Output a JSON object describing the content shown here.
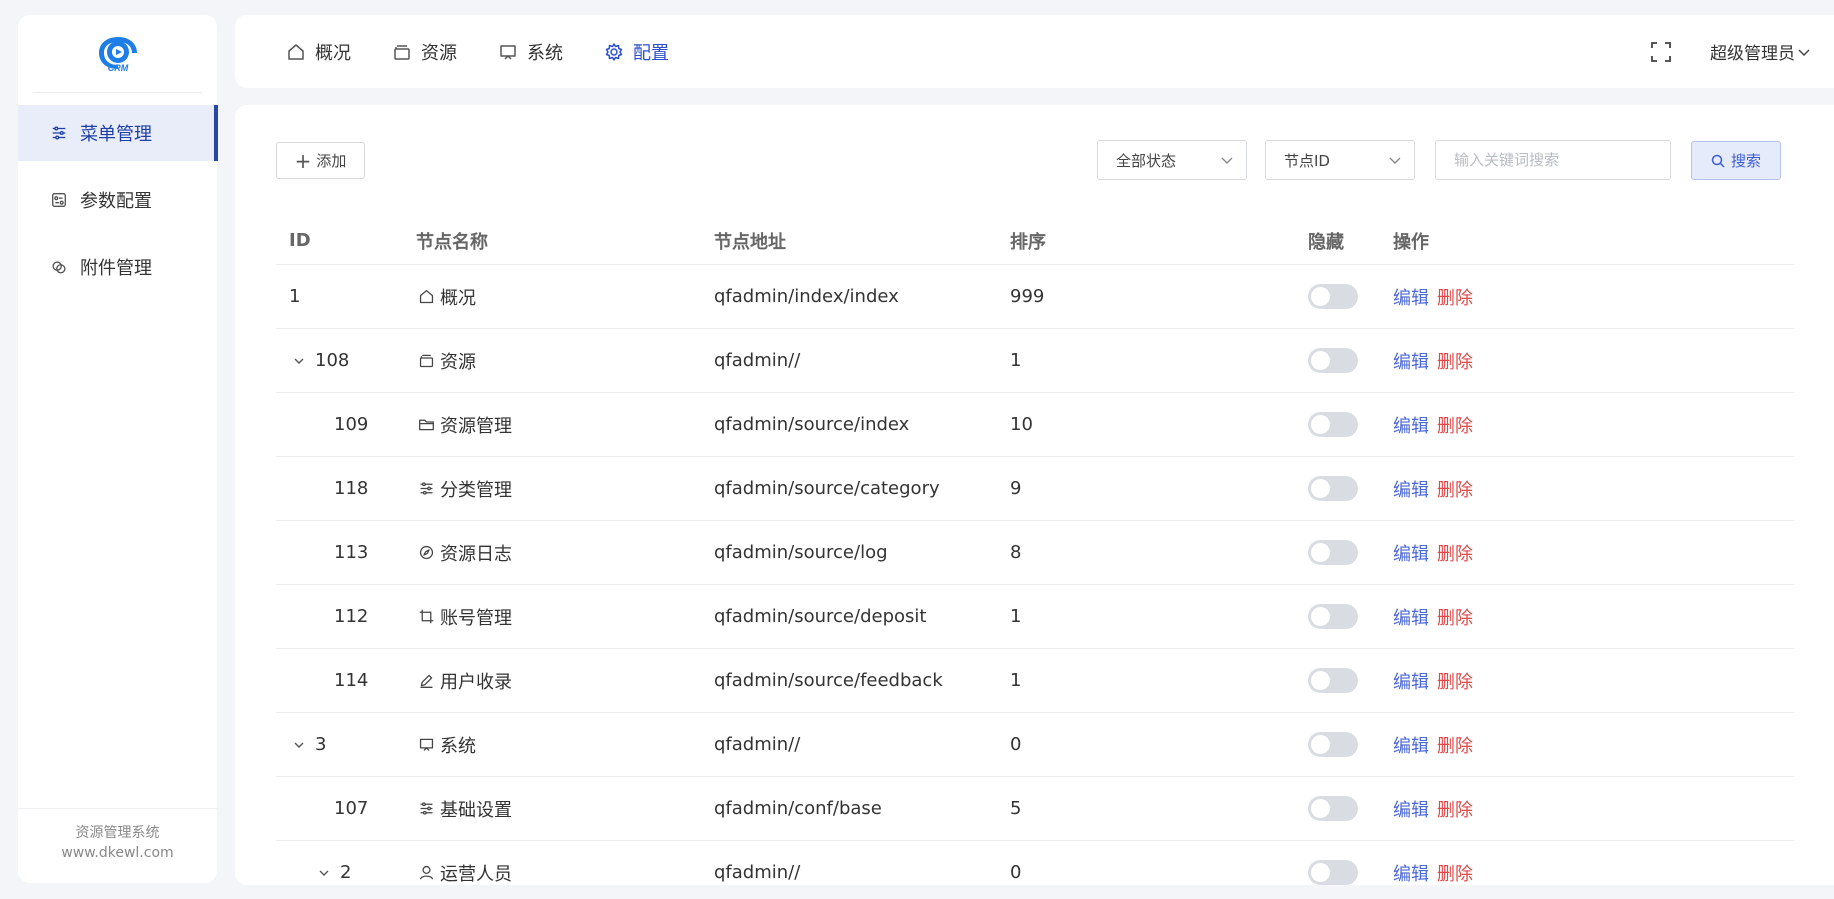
{
  "sidebar": {
    "logo_text": "CRM",
    "items": [
      {
        "label": "菜单管理",
        "icon": "sliders-icon",
        "active": true
      },
      {
        "label": "参数配置",
        "icon": "settings-panel-icon",
        "active": false
      },
      {
        "label": "附件管理",
        "icon": "attachment-icon",
        "active": false
      }
    ],
    "footer_line1": "资源管理系统",
    "footer_line2": "www.dkewl.com"
  },
  "topnav": {
    "items": [
      {
        "label": "概况",
        "icon": "home-icon",
        "active": false
      },
      {
        "label": "资源",
        "icon": "inbox-icon",
        "active": false
      },
      {
        "label": "系统",
        "icon": "monitor-icon",
        "active": false
      },
      {
        "label": "配置",
        "icon": "gear-icon",
        "active": true
      }
    ],
    "user_label": "超级管理员"
  },
  "toolbar": {
    "add_label": "添加",
    "status_select": "全部状态",
    "node_select": "节点ID",
    "search_placeholder": "输入关键词搜索",
    "search_label": "搜索"
  },
  "table": {
    "headers": [
      "ID",
      "节点名称",
      "节点地址",
      "排序",
      "隐藏",
      "操作"
    ],
    "edit_label": "编辑",
    "delete_label": "删除",
    "rows": [
      {
        "id": "1",
        "level": 0,
        "expandable": false,
        "name": "概况",
        "icon": "home-icon",
        "path": "qfadmin/index/index",
        "sort": "999"
      },
      {
        "id": "108",
        "level": 0,
        "expandable": true,
        "name": "资源",
        "icon": "inbox-icon",
        "path": "qfadmin//",
        "sort": "1"
      },
      {
        "id": "109",
        "level": 1,
        "expandable": false,
        "name": "资源管理",
        "icon": "folder-icon",
        "path": "qfadmin/source/index",
        "sort": "10"
      },
      {
        "id": "118",
        "level": 1,
        "expandable": false,
        "name": "分类管理",
        "icon": "sliders-icon",
        "path": "qfadmin/source/category",
        "sort": "9"
      },
      {
        "id": "113",
        "level": 1,
        "expandable": false,
        "name": "资源日志",
        "icon": "compass-icon",
        "path": "qfadmin/source/log",
        "sort": "8"
      },
      {
        "id": "112",
        "level": 1,
        "expandable": false,
        "name": "账号管理",
        "icon": "crop-icon",
        "path": "qfadmin/source/deposit",
        "sort": "1"
      },
      {
        "id": "114",
        "level": 1,
        "expandable": false,
        "name": "用户收录",
        "icon": "edit-icon",
        "path": "qfadmin/source/feedback",
        "sort": "1"
      },
      {
        "id": "3",
        "level": 0,
        "expandable": true,
        "name": "系统",
        "icon": "monitor-icon",
        "path": "qfadmin//",
        "sort": "0"
      },
      {
        "id": "107",
        "level": 1,
        "expandable": false,
        "name": "基础设置",
        "icon": "sliders-icon",
        "path": "qfadmin/conf/base",
        "sort": "5"
      },
      {
        "id": "2",
        "level": 1,
        "expandable": true,
        "name": "运营人员",
        "icon": "user-icon",
        "path": "qfadmin//",
        "sort": "0"
      }
    ]
  },
  "colors": {
    "accent": "#2c4fd0",
    "danger": "#e04848",
    "sidebar_active_bg": "#e8edf9"
  }
}
